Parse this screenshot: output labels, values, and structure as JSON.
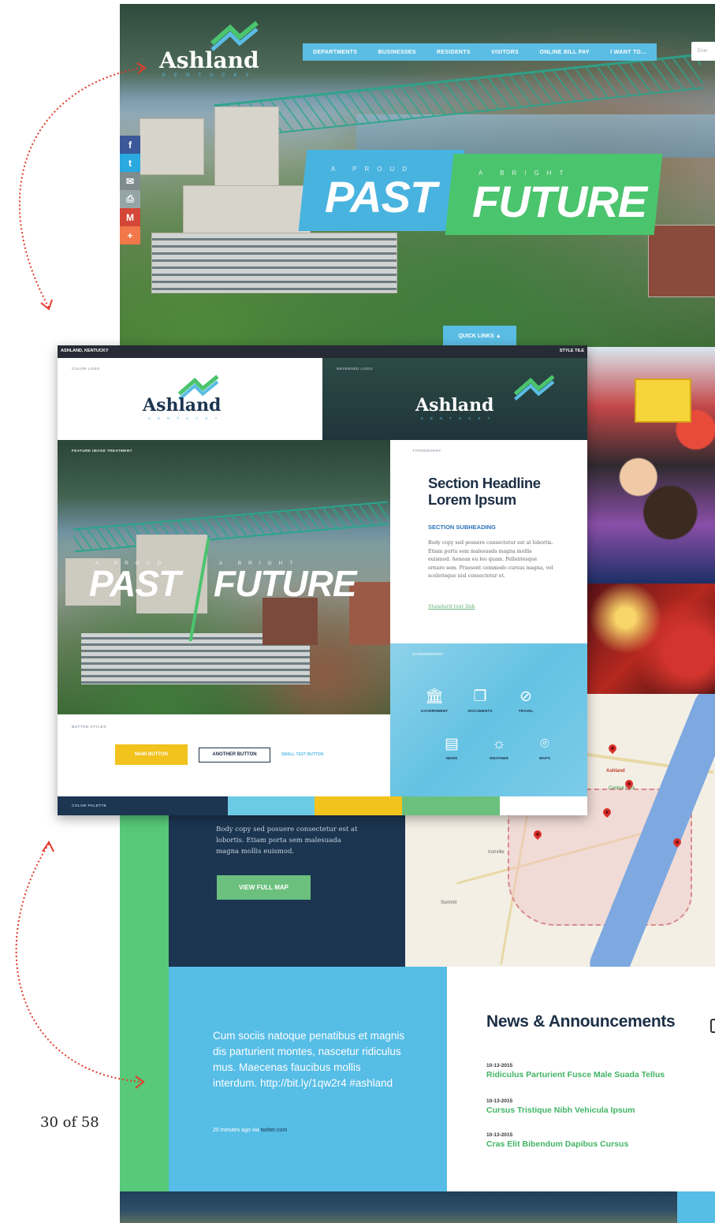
{
  "home": {
    "logo": {
      "word": "Ashland",
      "sub": "KENTUCKY"
    },
    "nav": [
      "DEPARTMENTS",
      "BUSINESSES",
      "RESIDENTS",
      "VISITORS",
      "ONLINE BILL PAY",
      "I WANT TO..."
    ],
    "search_placeholder": "Ente",
    "social": [
      "f",
      "t",
      "✉",
      "⎙",
      "M",
      "+"
    ],
    "hero": {
      "past_small": "A PROUD",
      "past_big": "PAST",
      "future_small": "A BRIGHT",
      "future_big": "FUTURE"
    },
    "quick_links": "QUICK LINKS ▲",
    "map": {
      "body": "Body copy sed posuere consectetur est at lobortis. Etiam porta sem malesuada magna mollis euismod.",
      "button": "VIEW FULL MAP",
      "labels": {
        "ashland": "Ashland",
        "central_park": "Central Park",
        "ironville": "Ironville",
        "summit": "Summit"
      }
    },
    "tweet": {
      "text": "Cum sociis natoque penatibus et magnis dis parturient montes, nascetur ridiculus mus. Maecenas faucibus mollis interdum. http://bit.ly/1qw2r4  #ashland",
      "meta_prefix": "20 minutes ago via ",
      "meta_link": "twitter.com"
    },
    "news": {
      "title": "News & Announcements",
      "items": [
        {
          "date": "10-13-2015",
          "title": "Ridiculus Parturient Fusce Male Suada Tellus"
        },
        {
          "date": "10-13-2015",
          "title": "Cursus Tristique Nibh Vehicula Ipsum"
        },
        {
          "date": "10-13-2015",
          "title": "Cras Elit Bibendum Dapibus Cursus"
        }
      ]
    }
  },
  "tile": {
    "header_left": "ASHLAND, KENTUCKY",
    "header_right": "STYLE TILE",
    "labels": {
      "color_logo": "COLOR LOGO",
      "reversed_logo": "REVERSED LOGO",
      "feature": "FEATURE IMAGE TREATMENT",
      "typography": "TYPOGRAPHY",
      "iconography": "ICONOGRAPHY",
      "buttons": "BUTTON STYLES",
      "palette": "COLOR PALETTE"
    },
    "logo": {
      "word": "Ashland",
      "sub": "KENTUCKY"
    },
    "feature": {
      "past_small": "A PROUD",
      "past_big": "PAST",
      "future_small": "A BRIGHT",
      "future_big": "FUTURE"
    },
    "typography": {
      "headline": "Section Headline Lorem Ipsum",
      "subheading": "SECTION SUBHEADING",
      "body": "Body copy sed posuere consectetur est at lobortis. Etiam porta sem malesuada magna mollis euismod. Aenean eu leo quam. Pellentesque ornare sem. Praesent commodo cursus magna, vel scelerisque nisl consectetur et.",
      "link": "Standard text link"
    },
    "icons": [
      {
        "name": "government-icon",
        "glyph": "🏛",
        "label": "GOVERNMENT"
      },
      {
        "name": "documents-icon",
        "glyph": "❐",
        "label": "DOCUMENTS"
      },
      {
        "name": "travel-icon",
        "glyph": "⊘",
        "label": "TRAVEL"
      },
      {
        "name": "news-icon",
        "glyph": "▤",
        "label": "NEWS"
      },
      {
        "name": "weather-icon",
        "glyph": "☼",
        "label": "WEATHER"
      },
      {
        "name": "maps-icon",
        "glyph": "⌾",
        "label": "MAPS"
      }
    ],
    "buttons": {
      "main": "MAIN BUTTON",
      "another": "ANOTHER BUTTON",
      "small": "SMALL TEXT BUTTON"
    },
    "palette": [
      "#1c3551",
      "#6ccbe4",
      "#f2c21d",
      "#6bc07e",
      "#ffffff"
    ]
  },
  "page_number": "30 of 58",
  "colors": {
    "blue": "#56bde6",
    "green": "#57c978",
    "navy": "#1c3551",
    "yellow": "#f2c21d",
    "arrow": "#e53a2b"
  }
}
